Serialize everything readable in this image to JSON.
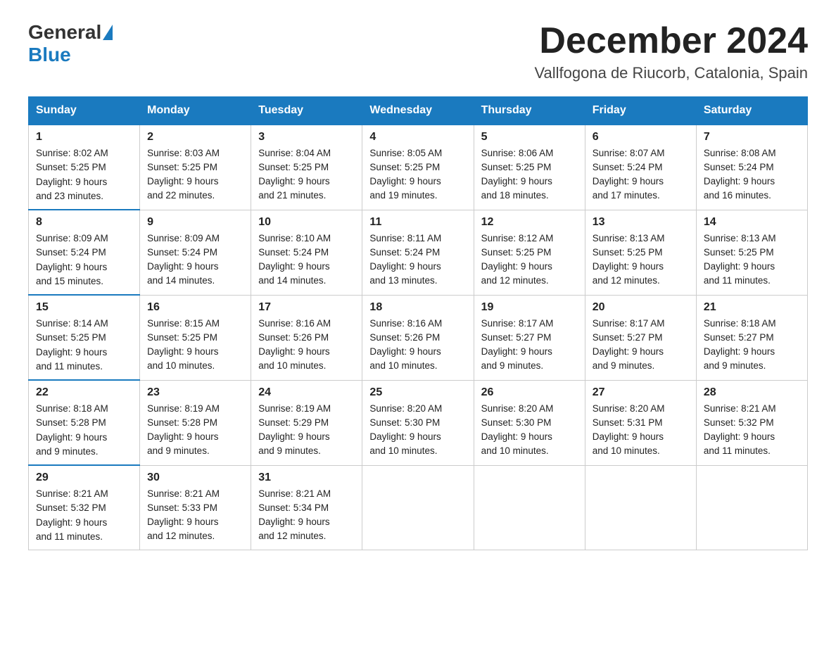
{
  "header": {
    "logo_general": "General",
    "logo_blue": "Blue",
    "title": "December 2024",
    "subtitle": "Vallfogona de Riucorb, Catalonia, Spain"
  },
  "days_of_week": [
    "Sunday",
    "Monday",
    "Tuesday",
    "Wednesday",
    "Thursday",
    "Friday",
    "Saturday"
  ],
  "weeks": [
    [
      {
        "day": "1",
        "sunrise": "8:02 AM",
        "sunset": "5:25 PM",
        "daylight": "9 hours and 23 minutes."
      },
      {
        "day": "2",
        "sunrise": "8:03 AM",
        "sunset": "5:25 PM",
        "daylight": "9 hours and 22 minutes."
      },
      {
        "day": "3",
        "sunrise": "8:04 AM",
        "sunset": "5:25 PM",
        "daylight": "9 hours and 21 minutes."
      },
      {
        "day": "4",
        "sunrise": "8:05 AM",
        "sunset": "5:25 PM",
        "daylight": "9 hours and 19 minutes."
      },
      {
        "day": "5",
        "sunrise": "8:06 AM",
        "sunset": "5:25 PM",
        "daylight": "9 hours and 18 minutes."
      },
      {
        "day": "6",
        "sunrise": "8:07 AM",
        "sunset": "5:24 PM",
        "daylight": "9 hours and 17 minutes."
      },
      {
        "day": "7",
        "sunrise": "8:08 AM",
        "sunset": "5:24 PM",
        "daylight": "9 hours and 16 minutes."
      }
    ],
    [
      {
        "day": "8",
        "sunrise": "8:09 AM",
        "sunset": "5:24 PM",
        "daylight": "9 hours and 15 minutes."
      },
      {
        "day": "9",
        "sunrise": "8:09 AM",
        "sunset": "5:24 PM",
        "daylight": "9 hours and 14 minutes."
      },
      {
        "day": "10",
        "sunrise": "8:10 AM",
        "sunset": "5:24 PM",
        "daylight": "9 hours and 14 minutes."
      },
      {
        "day": "11",
        "sunrise": "8:11 AM",
        "sunset": "5:24 PM",
        "daylight": "9 hours and 13 minutes."
      },
      {
        "day": "12",
        "sunrise": "8:12 AM",
        "sunset": "5:25 PM",
        "daylight": "9 hours and 12 minutes."
      },
      {
        "day": "13",
        "sunrise": "8:13 AM",
        "sunset": "5:25 PM",
        "daylight": "9 hours and 12 minutes."
      },
      {
        "day": "14",
        "sunrise": "8:13 AM",
        "sunset": "5:25 PM",
        "daylight": "9 hours and 11 minutes."
      }
    ],
    [
      {
        "day": "15",
        "sunrise": "8:14 AM",
        "sunset": "5:25 PM",
        "daylight": "9 hours and 11 minutes."
      },
      {
        "day": "16",
        "sunrise": "8:15 AM",
        "sunset": "5:25 PM",
        "daylight": "9 hours and 10 minutes."
      },
      {
        "day": "17",
        "sunrise": "8:16 AM",
        "sunset": "5:26 PM",
        "daylight": "9 hours and 10 minutes."
      },
      {
        "day": "18",
        "sunrise": "8:16 AM",
        "sunset": "5:26 PM",
        "daylight": "9 hours and 10 minutes."
      },
      {
        "day": "19",
        "sunrise": "8:17 AM",
        "sunset": "5:27 PM",
        "daylight": "9 hours and 9 minutes."
      },
      {
        "day": "20",
        "sunrise": "8:17 AM",
        "sunset": "5:27 PM",
        "daylight": "9 hours and 9 minutes."
      },
      {
        "day": "21",
        "sunrise": "8:18 AM",
        "sunset": "5:27 PM",
        "daylight": "9 hours and 9 minutes."
      }
    ],
    [
      {
        "day": "22",
        "sunrise": "8:18 AM",
        "sunset": "5:28 PM",
        "daylight": "9 hours and 9 minutes."
      },
      {
        "day": "23",
        "sunrise": "8:19 AM",
        "sunset": "5:28 PM",
        "daylight": "9 hours and 9 minutes."
      },
      {
        "day": "24",
        "sunrise": "8:19 AM",
        "sunset": "5:29 PM",
        "daylight": "9 hours and 9 minutes."
      },
      {
        "day": "25",
        "sunrise": "8:20 AM",
        "sunset": "5:30 PM",
        "daylight": "9 hours and 10 minutes."
      },
      {
        "day": "26",
        "sunrise": "8:20 AM",
        "sunset": "5:30 PM",
        "daylight": "9 hours and 10 minutes."
      },
      {
        "day": "27",
        "sunrise": "8:20 AM",
        "sunset": "5:31 PM",
        "daylight": "9 hours and 10 minutes."
      },
      {
        "day": "28",
        "sunrise": "8:21 AM",
        "sunset": "5:32 PM",
        "daylight": "9 hours and 11 minutes."
      }
    ],
    [
      {
        "day": "29",
        "sunrise": "8:21 AM",
        "sunset": "5:32 PM",
        "daylight": "9 hours and 11 minutes."
      },
      {
        "day": "30",
        "sunrise": "8:21 AM",
        "sunset": "5:33 PM",
        "daylight": "9 hours and 12 minutes."
      },
      {
        "day": "31",
        "sunrise": "8:21 AM",
        "sunset": "5:34 PM",
        "daylight": "9 hours and 12 minutes."
      },
      null,
      null,
      null,
      null
    ]
  ],
  "labels": {
    "sunrise": "Sunrise:",
    "sunset": "Sunset:",
    "daylight": "Daylight:"
  }
}
